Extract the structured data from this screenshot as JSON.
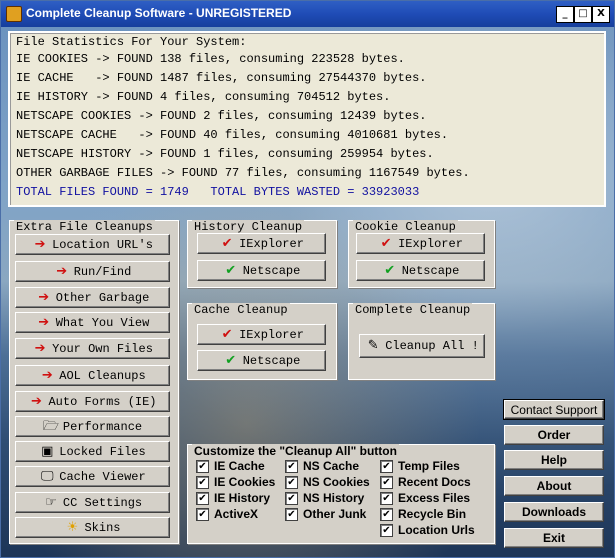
{
  "window": {
    "title": "Complete Cleanup Software - UNREGISTERED"
  },
  "titlebar_buttons": {
    "minimize": "_",
    "maximize": "□",
    "close": "X"
  },
  "stats": {
    "header": "File Statistics For Your System:",
    "lines": [
      "IE COOKIES -> FOUND 138 files, consuming 223528 bytes.",
      "IE CACHE   -> FOUND 1487 files, consuming 27544370 bytes.",
      "IE HISTORY -> FOUND 4 files, consuming 704512 bytes.",
      "NETSCAPE COOKIES -> FOUND 2 files, consuming 12439 bytes.",
      "NETSCAPE CACHE   -> FOUND 40 files, consuming 4010681 bytes.",
      "NETSCAPE HISTORY -> FOUND 1 files, consuming 259954 bytes.",
      "OTHER GARBAGE FILES -> FOUND 77 files, consuming 1167549 bytes."
    ],
    "total": "TOTAL FILES FOUND = 1749   TOTAL BYTES WASTED = 33923033"
  },
  "extra": {
    "title": "Extra File Cleanups",
    "buttons": [
      {
        "label": "Location URL's",
        "icon": "red-arrow-icon"
      },
      {
        "label": "Run/Find",
        "icon": "red-arrow-icon"
      },
      {
        "label": "Other Garbage",
        "icon": "red-arrow-icon"
      },
      {
        "label": "What You View",
        "icon": "red-arrow-icon"
      },
      {
        "label": "Your Own Files",
        "icon": "red-arrow-icon"
      },
      {
        "label": "AOL Cleanups",
        "icon": "red-arrow-icon"
      },
      {
        "label": "Auto Forms (IE)",
        "icon": "red-arrow-icon"
      },
      {
        "label": "Performance",
        "icon": "performance-icon"
      },
      {
        "label": "Locked Files",
        "icon": "lock-icon"
      },
      {
        "label": "Cache Viewer",
        "icon": "monitor-icon"
      },
      {
        "label": "CC Settings",
        "icon": "settings-icon"
      },
      {
        "label": "Skins",
        "icon": "sun-icon"
      }
    ]
  },
  "history": {
    "title": "History Cleanup",
    "ie": "IExplorer",
    "ns": "Netscape"
  },
  "cookie": {
    "title": "Cookie Cleanup",
    "ie": "IExplorer",
    "ns": "Netscape"
  },
  "cache": {
    "title": "Cache Cleanup",
    "ie": "IExplorer",
    "ns": "Netscape"
  },
  "complete": {
    "title": "Complete Cleanup",
    "button": "Cleanup All !"
  },
  "customize": {
    "title": "Customize the \"Cleanup All\" button",
    "col1": [
      "IE Cache",
      "IE Cookies",
      "IE History",
      "ActiveX"
    ],
    "col2": [
      "NS Cache",
      "NS Cookies",
      "NS History",
      "Other Junk"
    ],
    "col3": [
      "Temp Files",
      "Recent Docs",
      "Excess Files",
      "Recycle Bin",
      "Location Urls"
    ]
  },
  "side": {
    "contact": "Contact Support",
    "order": "Order",
    "help": "Help",
    "about": "About",
    "downloads": "Downloads",
    "exit": "Exit"
  }
}
